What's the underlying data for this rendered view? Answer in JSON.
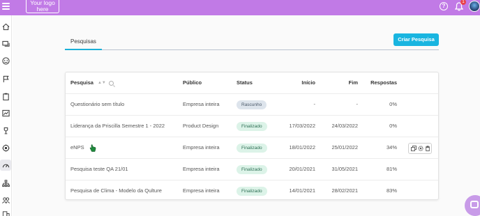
{
  "header": {
    "logo_line1": "Your logo",
    "logo_line2": "here",
    "notification_count": "1",
    "help_label": "?",
    "bar_color": "#c17ae6"
  },
  "sidebar": {
    "items": [
      "home-icon",
      "chat-icon",
      "mood-icon",
      "flag-icon",
      "clipboard-icon",
      "chart-icon",
      "trophy-icon",
      "target-icon",
      "dashboard-icon",
      "org-chart-icon",
      "people-icon",
      "building-icon"
    ],
    "active": "dashboard-icon"
  },
  "tabs": {
    "active_label": "Pesquisas"
  },
  "create_button": "Criar Pesquisa",
  "table": {
    "columns": {
      "name": "Pesquisa",
      "public": "Público",
      "status": "Status",
      "start": "Início",
      "end": "Fim",
      "responses": "Respostas"
    },
    "rows": [
      {
        "name": "Questionário sem título",
        "public": "Empresa inteira",
        "status": "Rascunho",
        "start": "-",
        "end": "-",
        "responses": "0%"
      },
      {
        "name": "Liderança da Priscilla Semestre 1 - 2022",
        "public": "Product Design",
        "status": "Finalizado",
        "start": "17/03/2022",
        "end": "24/03/2022",
        "responses": "0%"
      },
      {
        "name": "eNPS",
        "public": "Empresa inteira",
        "status": "Finalizado",
        "start": "18/01/2022",
        "end": "25/01/2022",
        "responses": "34%"
      },
      {
        "name": "Pesquisa teste QA 21/01",
        "public": "Empresa inteira",
        "status": "Finalizado",
        "start": "20/01/2021",
        "end": "31/05/2021",
        "responses": "81%"
      },
      {
        "name": "Pesquisa de Clima - Modelo da Qulture",
        "public": "Empresa inteira",
        "status": "Finalizado",
        "start": "14/01/2021",
        "end": "28/02/2021",
        "responses": "83%"
      }
    ]
  },
  "colors": {
    "accent": "#19b5e0",
    "draft_badge": "#dde4ec",
    "done_badge": "#dcf3e8"
  }
}
